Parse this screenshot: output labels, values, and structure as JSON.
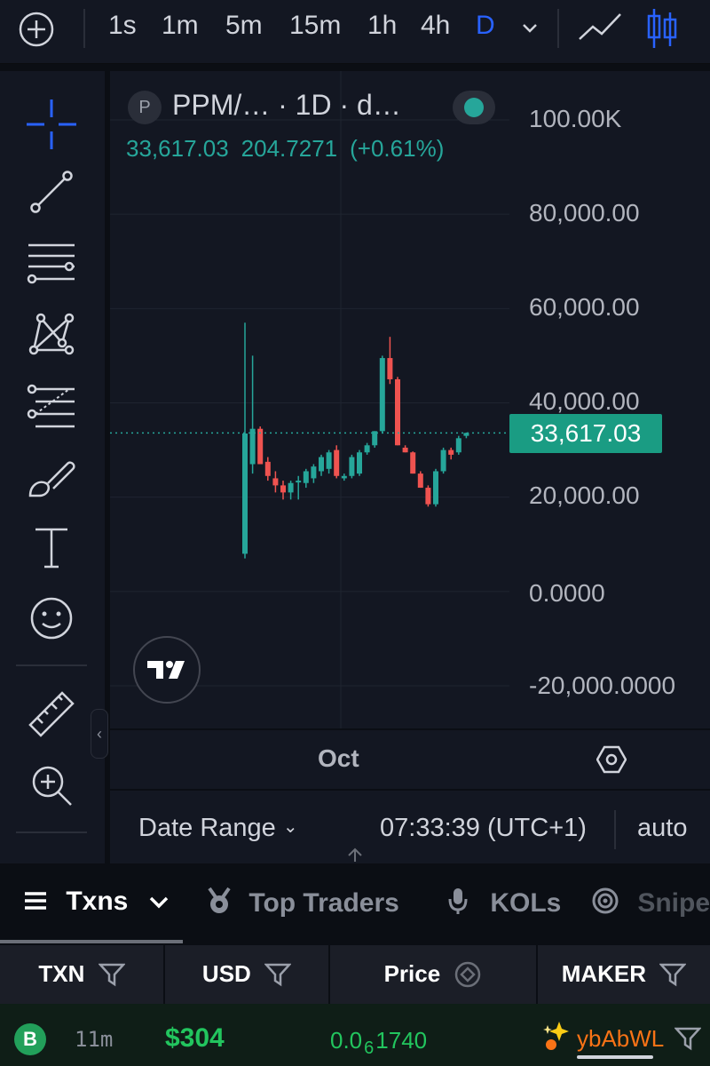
{
  "toolbar": {
    "timeframes": [
      "1s",
      "1m",
      "5m",
      "15m",
      "1h",
      "4h",
      "D"
    ],
    "active_timeframe": "D",
    "icons": [
      "plus-circle-icon",
      "chevron-down-icon",
      "line-chart-icon",
      "candlestick-icon"
    ]
  },
  "drawing_tools": [
    "crosshair",
    "trend-line",
    "horizontal-lines",
    "xabcd-pattern",
    "fib-retracement",
    "brush",
    "text",
    "emoji",
    "ruler",
    "zoom-in"
  ],
  "legend": {
    "symbol_badge": "P",
    "symbol_text": "PPM/… · 1D · d…",
    "close": "33,617.03",
    "change": "204.7271",
    "change_pct": "(+0.61%)"
  },
  "colors": {
    "up": "#26a69a",
    "down": "#ef5350",
    "accent": "#2962ff",
    "background": "#131722"
  },
  "chart_data": {
    "type": "candlestick",
    "x_label_visible": "Oct",
    "y_ticks": [
      "100.00K",
      "80,000.00",
      "60,000.00",
      "40,000.00",
      "20,000.00",
      "0.0000",
      "-20,000.0000"
    ],
    "ylim": [
      -20000,
      100000
    ],
    "last_price": 33617.03,
    "last_price_label": "33,617.03",
    "candles": [
      {
        "o": 8000,
        "h": 57000,
        "l": 7000,
        "c": 33500
      },
      {
        "o": 27000,
        "h": 50000,
        "l": 25000,
        "c": 34500
      },
      {
        "o": 34500,
        "h": 35000,
        "l": 27000,
        "c": 27000
      },
      {
        "o": 27500,
        "h": 28500,
        "l": 23500,
        "c": 24500
      },
      {
        "o": 24000,
        "h": 25500,
        "l": 21000,
        "c": 22500
      },
      {
        "o": 22500,
        "h": 23500,
        "l": 19500,
        "c": 21000
      },
      {
        "o": 21000,
        "h": 23500,
        "l": 19500,
        "c": 23000
      },
      {
        "o": 23500,
        "h": 24500,
        "l": 19500,
        "c": 23500
      },
      {
        "o": 23000,
        "h": 26000,
        "l": 22000,
        "c": 25500
      },
      {
        "o": 24000,
        "h": 27000,
        "l": 23000,
        "c": 26500
      },
      {
        "o": 25500,
        "h": 29000,
        "l": 24500,
        "c": 28500
      },
      {
        "o": 26000,
        "h": 30000,
        "l": 25000,
        "c": 29500
      },
      {
        "o": 30000,
        "h": 31000,
        "l": 24000,
        "c": 24500
      },
      {
        "o": 24000,
        "h": 25000,
        "l": 23500,
        "c": 24500
      },
      {
        "o": 24500,
        "h": 29000,
        "l": 24000,
        "c": 28500
      },
      {
        "o": 25000,
        "h": 30000,
        "l": 24500,
        "c": 29500
      },
      {
        "o": 29500,
        "h": 31500,
        "l": 29000,
        "c": 31000
      },
      {
        "o": 31000,
        "h": 34000,
        "l": 30500,
        "c": 34000
      },
      {
        "o": 34000,
        "h": 50000,
        "l": 33500,
        "c": 49500
      },
      {
        "o": 49500,
        "h": 54000,
        "l": 44000,
        "c": 45000
      },
      {
        "o": 45000,
        "h": 45500,
        "l": 31000,
        "c": 31000
      },
      {
        "o": 30500,
        "h": 31000,
        "l": 29500,
        "c": 29500
      },
      {
        "o": 29500,
        "h": 29700,
        "l": 25000,
        "c": 25000
      },
      {
        "o": 25000,
        "h": 25500,
        "l": 22000,
        "c": 22000
      },
      {
        "o": 22000,
        "h": 22500,
        "l": 18000,
        "c": 18500
      },
      {
        "o": 18500,
        "h": 26000,
        "l": 18000,
        "c": 25500
      },
      {
        "o": 25500,
        "h": 30500,
        "l": 25000,
        "c": 30000
      },
      {
        "o": 30000,
        "h": 30500,
        "l": 28000,
        "c": 29000
      },
      {
        "o": 29500,
        "h": 33000,
        "l": 29000,
        "c": 32500
      },
      {
        "o": 33000,
        "h": 33700,
        "l": 32500,
        "c": 33617
      }
    ]
  },
  "time_axis": {
    "label": "Oct"
  },
  "bottom_bar": {
    "date_range": "Date Range",
    "clock": "07:33:39 (UTC+1)",
    "scale_mode": "auto"
  },
  "tabs": [
    {
      "label": "Txns",
      "icon": "list-icon",
      "active": true
    },
    {
      "label": "Top Traders",
      "icon": "medal-icon"
    },
    {
      "label": "KOLs",
      "icon": "microphone-icon"
    },
    {
      "label": "Snipe",
      "icon": "target-icon"
    }
  ],
  "table": {
    "headers": [
      "TXN",
      "USD",
      "Price",
      "MAKER"
    ],
    "rows": [
      {
        "type": "B",
        "age": "11m",
        "usd": "$304",
        "price_prefix": "0.0",
        "price_zeros": "6",
        "price_digits": "1740",
        "maker": "ybAbWL"
      }
    ]
  }
}
